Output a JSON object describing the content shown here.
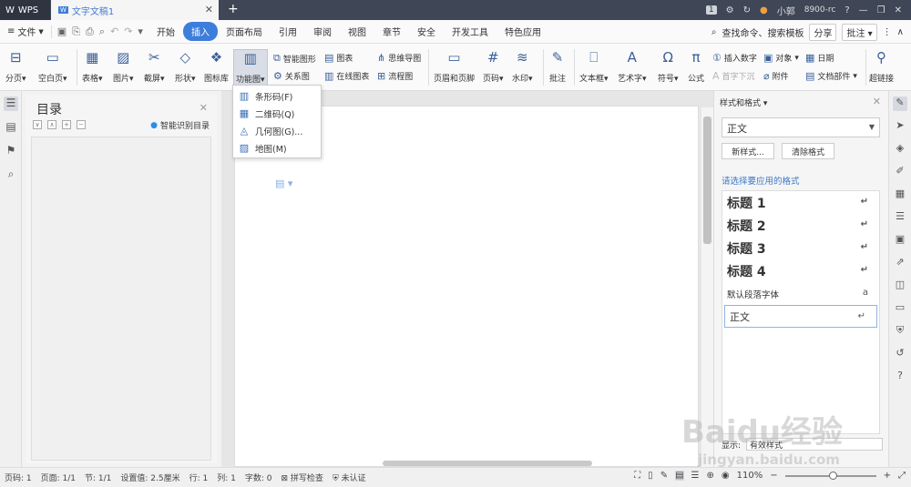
{
  "titlebar": {
    "app_label": "WPS",
    "doc_tab": "文字文稿1",
    "page_count": "1",
    "user_name": "小郭",
    "user_sub": "8900-rc"
  },
  "menubar": {
    "file": "文件",
    "tabs": [
      "开始",
      "插入",
      "页面布局",
      "引用",
      "审阅",
      "视图",
      "章节",
      "安全",
      "开发工具",
      "特色应用"
    ],
    "search": "查找命令、搜索模板",
    "share": "分享",
    "comment": "批注"
  },
  "ribbon": {
    "page_break": "分页",
    "blank_page": "空白页",
    "table": "表格",
    "picture": "图片",
    "screenshot": "截屏",
    "shape": "形状",
    "icon_lib": "图标库",
    "func_chart": "功能图",
    "smart_graphic": "智能图形",
    "relation": "关系图",
    "chart": "图表",
    "online_chart": "在线图表",
    "mind_map": "思维导图",
    "flow_chart": "流程图",
    "header_footer": "页眉和页脚",
    "page_number": "页码",
    "watermark": "水印",
    "comment": "批注",
    "textbox": "文本框",
    "art_text": "艺术字",
    "symbol": "符号",
    "formula": "公式",
    "insert_number": "插入数字",
    "first_drop": "首字下沉",
    "object": "对象",
    "attachment": "附件",
    "date": "日期",
    "doc_parts": "文档部件",
    "hyperlink": "超链接"
  },
  "dropdown": {
    "items": [
      {
        "icon": "barcode-icon",
        "label": "条形码(F)"
      },
      {
        "icon": "qrcode-icon",
        "label": "二维码(Q)"
      },
      {
        "icon": "geometry-icon",
        "label": "几何图(G)..."
      },
      {
        "icon": "map-icon",
        "label": "地图(M)"
      }
    ]
  },
  "toc": {
    "title": "目录",
    "smart_toc": "智能识别目录"
  },
  "style_panel": {
    "title": "样式和格式",
    "current_style": "正文",
    "new_style": "新样式...",
    "clear_format": "清除格式",
    "apply_label": "请选择要应用的格式",
    "items": [
      "标题 1",
      "标题 2",
      "标题 3",
      "标题 4",
      "默认段落字体",
      "正文"
    ],
    "show_label": "显示:",
    "show_value": "有效样式"
  },
  "statusbar": {
    "page_num": "页码: 1",
    "pages": "页面: 1/1",
    "section": "节: 1/1",
    "setting": "设置值: 2.5厘米",
    "row": "行: 1",
    "col": "列: 1",
    "words": "字数: 0",
    "spell": "拼写检查",
    "auth": "未认证",
    "zoom": "110%"
  },
  "watermark_text": {
    "brand": "Baidu经验",
    "url": "jingyan.baidu.com"
  },
  "colors": {
    "accent": "#3d7ddb",
    "titlebar": "#3f4656"
  }
}
